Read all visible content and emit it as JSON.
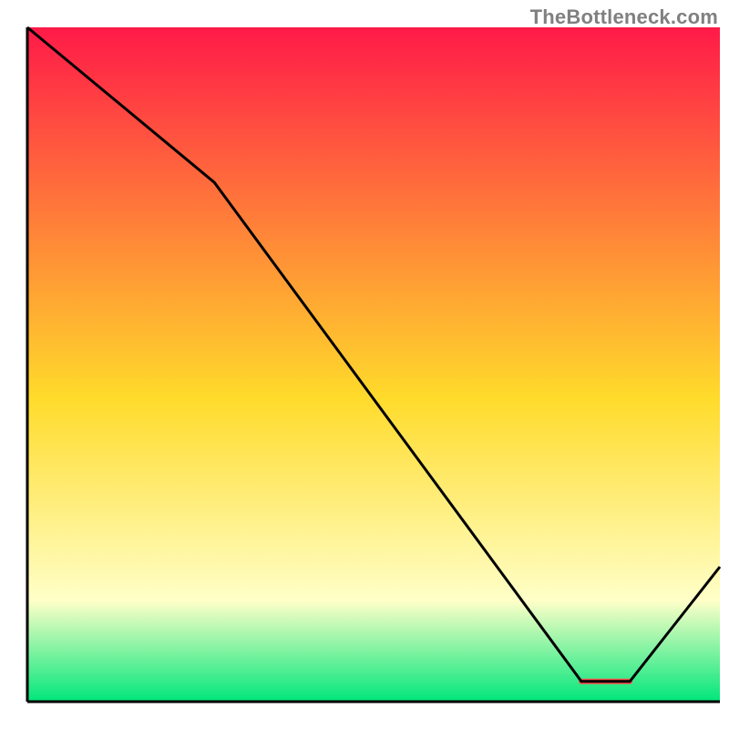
{
  "watermark": "TheBottleneck.com",
  "colors": {
    "top": "#ff1a48",
    "mid": "#ffdb2b",
    "pale": "#ffffc8",
    "bottom": "#00e67a",
    "line": "#000000",
    "axis": "#000000",
    "marker": "#ff4d4d"
  },
  "chart_data": {
    "type": "line",
    "title": "",
    "xlabel": "",
    "ylabel": "",
    "xlim": [
      0,
      100
    ],
    "ylim": [
      0,
      100
    ],
    "x": [
      0,
      27,
      80,
      87,
      100
    ],
    "values": [
      100,
      77,
      3,
      3,
      20
    ],
    "marker": {
      "x_start": 80,
      "x_end": 87,
      "y": 3
    },
    "annotations": []
  }
}
